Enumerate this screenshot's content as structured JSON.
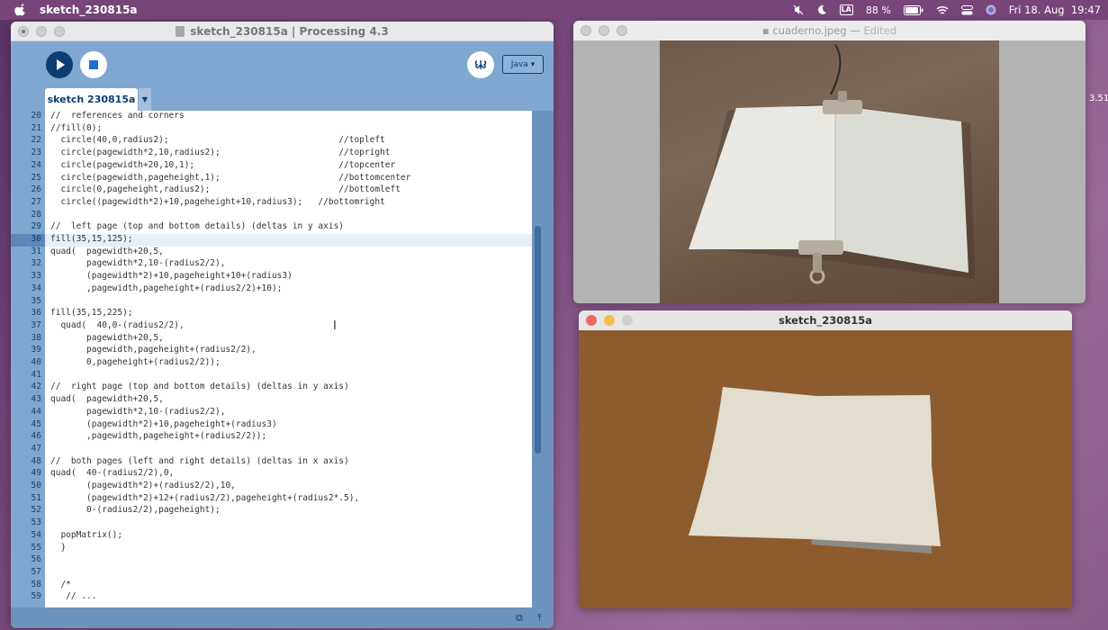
{
  "menubar": {
    "app_name": "sketch_230815a",
    "battery": "88 %",
    "input_source": "LA",
    "datetime": "Fri 18. Aug  19:47",
    "icons": [
      "apple-icon",
      "mute-icon",
      "moon-icon",
      "input-source-icon",
      "battery-icon",
      "wifi-icon",
      "control-center-icon",
      "siri-icon"
    ]
  },
  "desktop": {
    "partial_text": "3.51"
  },
  "processing": {
    "title": "sketch_230815a | Processing 4.3",
    "mode": "Java ▾",
    "tab": "sketch 230815a",
    "highlighted_line": 30,
    "code_lines": [
      {
        "n": "20",
        "t": "//  references and corners"
      },
      {
        "n": "21",
        "t": "//fill(0);"
      },
      {
        "n": "22",
        "t": "  circle(40,0,radius2);                                 //topleft"
      },
      {
        "n": "23",
        "t": "  circle(pagewidth*2,10,radius2);                       //topright"
      },
      {
        "n": "24",
        "t": "  circle(pagewidth+20,10,1);                            //topcenter"
      },
      {
        "n": "25",
        "t": "  circle(pagewidth,pageheight,1);                       //bottomcenter"
      },
      {
        "n": "26",
        "t": "  circle(0,pageheight,radius2);                         //bottomleft"
      },
      {
        "n": "27",
        "t": "  circle((pagewidth*2)+10,pageheight+10,radius3);   //bottomright"
      },
      {
        "n": "28",
        "t": ""
      },
      {
        "n": "29",
        "t": "//  left page (top and bottom details) (deltas in y axis)"
      },
      {
        "n": "30",
        "t": "fill(35,15,125);"
      },
      {
        "n": "31",
        "t": "quad(  pagewidth+20,5,"
      },
      {
        "n": "32",
        "t": "       pagewidth*2,10-(radius2/2),"
      },
      {
        "n": "33",
        "t": "       (pagewidth*2)+10,pageheight+10+(radius3)"
      },
      {
        "n": "34",
        "t": "       ,pagewidth,pageheight+(radius2/2)+10);"
      },
      {
        "n": "35",
        "t": ""
      },
      {
        "n": "36",
        "t": "fill(35,15,225);"
      },
      {
        "n": "37",
        "t": "  quad(  40,0-(radius2/2),"
      },
      {
        "n": "38",
        "t": "       pagewidth+20,5,"
      },
      {
        "n": "39",
        "t": "       pagewidth,pageheight+(radius2/2),"
      },
      {
        "n": "40",
        "t": "       0,pageheight+(radius2/2));"
      },
      {
        "n": "41",
        "t": ""
      },
      {
        "n": "42",
        "t": "//  right page (top and bottom details) (deltas in y axis)"
      },
      {
        "n": "43",
        "t": "quad(  pagewidth+20,5,"
      },
      {
        "n": "44",
        "t": "       pagewidth*2,10-(radius2/2),"
      },
      {
        "n": "45",
        "t": "       (pagewidth*2)+10,pageheight+(radius3)"
      },
      {
        "n": "46",
        "t": "       ,pagewidth,pageheight+(radius2/2));"
      },
      {
        "n": "47",
        "t": ""
      },
      {
        "n": "48",
        "t": "//  both pages (left and right details) (deltas in x axis)"
      },
      {
        "n": "49",
        "t": "quad(  40-(radius2/2),0,"
      },
      {
        "n": "50",
        "t": "       (pagewidth*2)+(radius2/2),10,"
      },
      {
        "n": "51",
        "t": "       (pagewidth*2)+12+(radius2/2),pageheight+(radius2*.5),"
      },
      {
        "n": "52",
        "t": "       0-(radius2/2),pageheight);"
      },
      {
        "n": "53",
        "t": ""
      },
      {
        "n": "54",
        "t": "  popMatrix();"
      },
      {
        "n": "55",
        "t": "  }"
      },
      {
        "n": "56",
        "t": ""
      },
      {
        "n": "57",
        "t": ""
      },
      {
        "n": "58",
        "t": "  /*"
      },
      {
        "n": "59",
        "t": "   // ..."
      }
    ]
  },
  "image_viewer": {
    "filename": "cuaderno.jpeg",
    "separator": "—",
    "state": "Edited"
  },
  "sketch_window": {
    "title": "sketch_230815a"
  },
  "colors": {
    "editor_bg": "#7fa7d0",
    "run_button": "#0b3d73",
    "sketch_bg": "#8c5c2f",
    "page": "#e3ddd0"
  }
}
